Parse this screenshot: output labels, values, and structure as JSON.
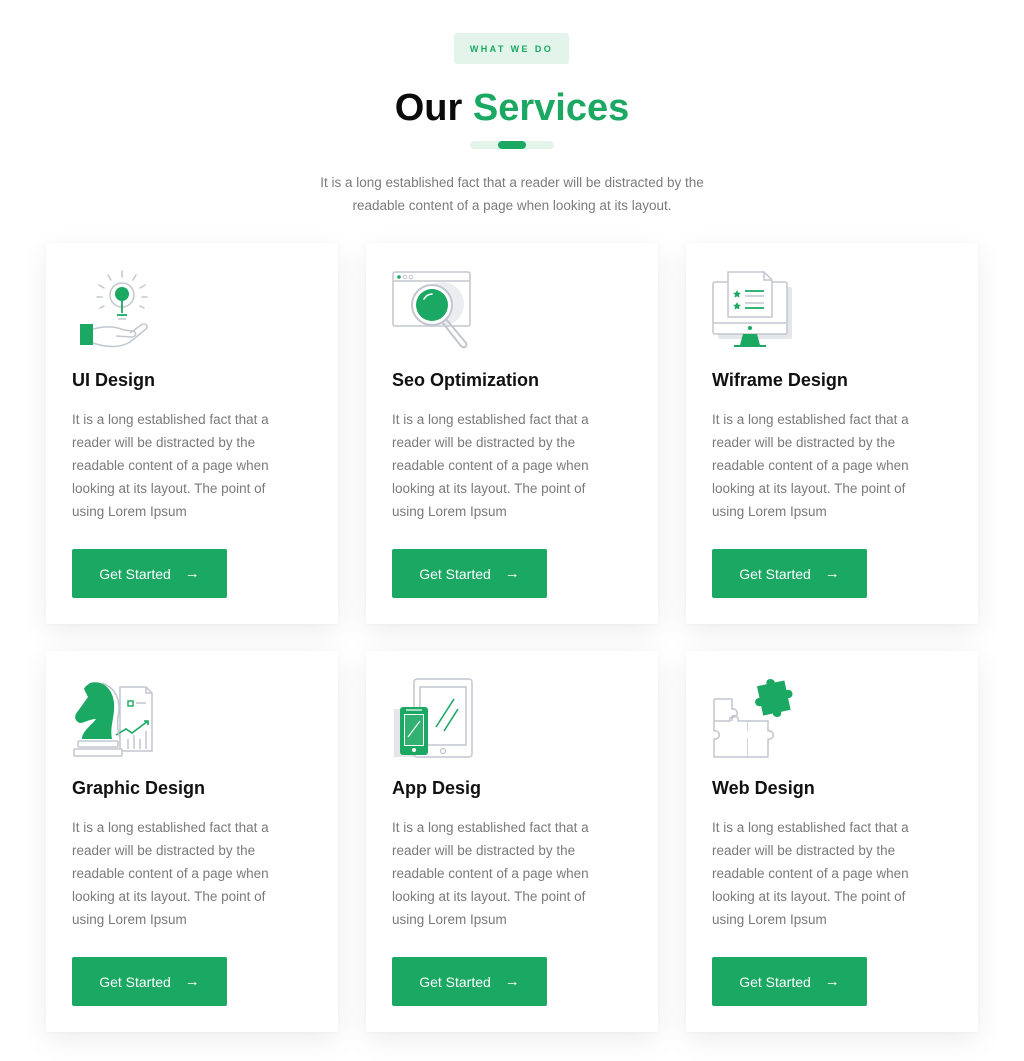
{
  "section": {
    "badge": "WHAT WE DO",
    "title_prefix": "Our",
    "title_accent": "Services",
    "intro": "It is a long established fact that a reader will be distracted by the readable content of a page when looking at its layout."
  },
  "colors": {
    "accent": "#1aa862",
    "accent_light": "#e3f4ea",
    "text": "#111111",
    "muted": "#7a7a7a"
  },
  "cards": [
    {
      "icon": "lightbulb-hand-icon",
      "title": "UI Design",
      "description": "It is a long established fact that a reader will be distracted by the readable content of a page when looking at its layout. The point of using Lorem Ipsum",
      "button": "Get Started",
      "arrow": "→"
    },
    {
      "icon": "magnifier-browser-icon",
      "title": "Seo Optimization",
      "description": "It is a long established fact that a reader will be distracted by the readable content of a page when looking at its layout. The point of using Lorem Ipsum",
      "button": "Get Started",
      "arrow": "→"
    },
    {
      "icon": "wireframe-monitor-icon",
      "title": "Wiframe Design",
      "description": "It is a long established fact that a reader will be distracted by the readable content of a page when looking at its layout. The point of using Lorem Ipsum",
      "button": "Get Started",
      "arrow": "→"
    },
    {
      "icon": "chess-knight-chart-icon",
      "title": "Graphic Design",
      "description": "It is a long established fact that a reader will be distracted by the readable content of a page when looking at its layout. The point of using Lorem Ipsum",
      "button": "Get Started",
      "arrow": "→"
    },
    {
      "icon": "phone-tablet-icon",
      "title": "App Desig",
      "description": "It is a long established fact that a reader will be distracted by the readable content of a page when looking at its layout. The point of using Lorem Ipsum",
      "button": "Get Started",
      "arrow": "→"
    },
    {
      "icon": "puzzle-pieces-icon",
      "title": "Web Design",
      "description": "It is a long established fact that a reader will be distracted by the readable content of a page when looking at its layout. The point of using Lorem Ipsum",
      "button": "Get Started",
      "arrow": "→"
    }
  ]
}
